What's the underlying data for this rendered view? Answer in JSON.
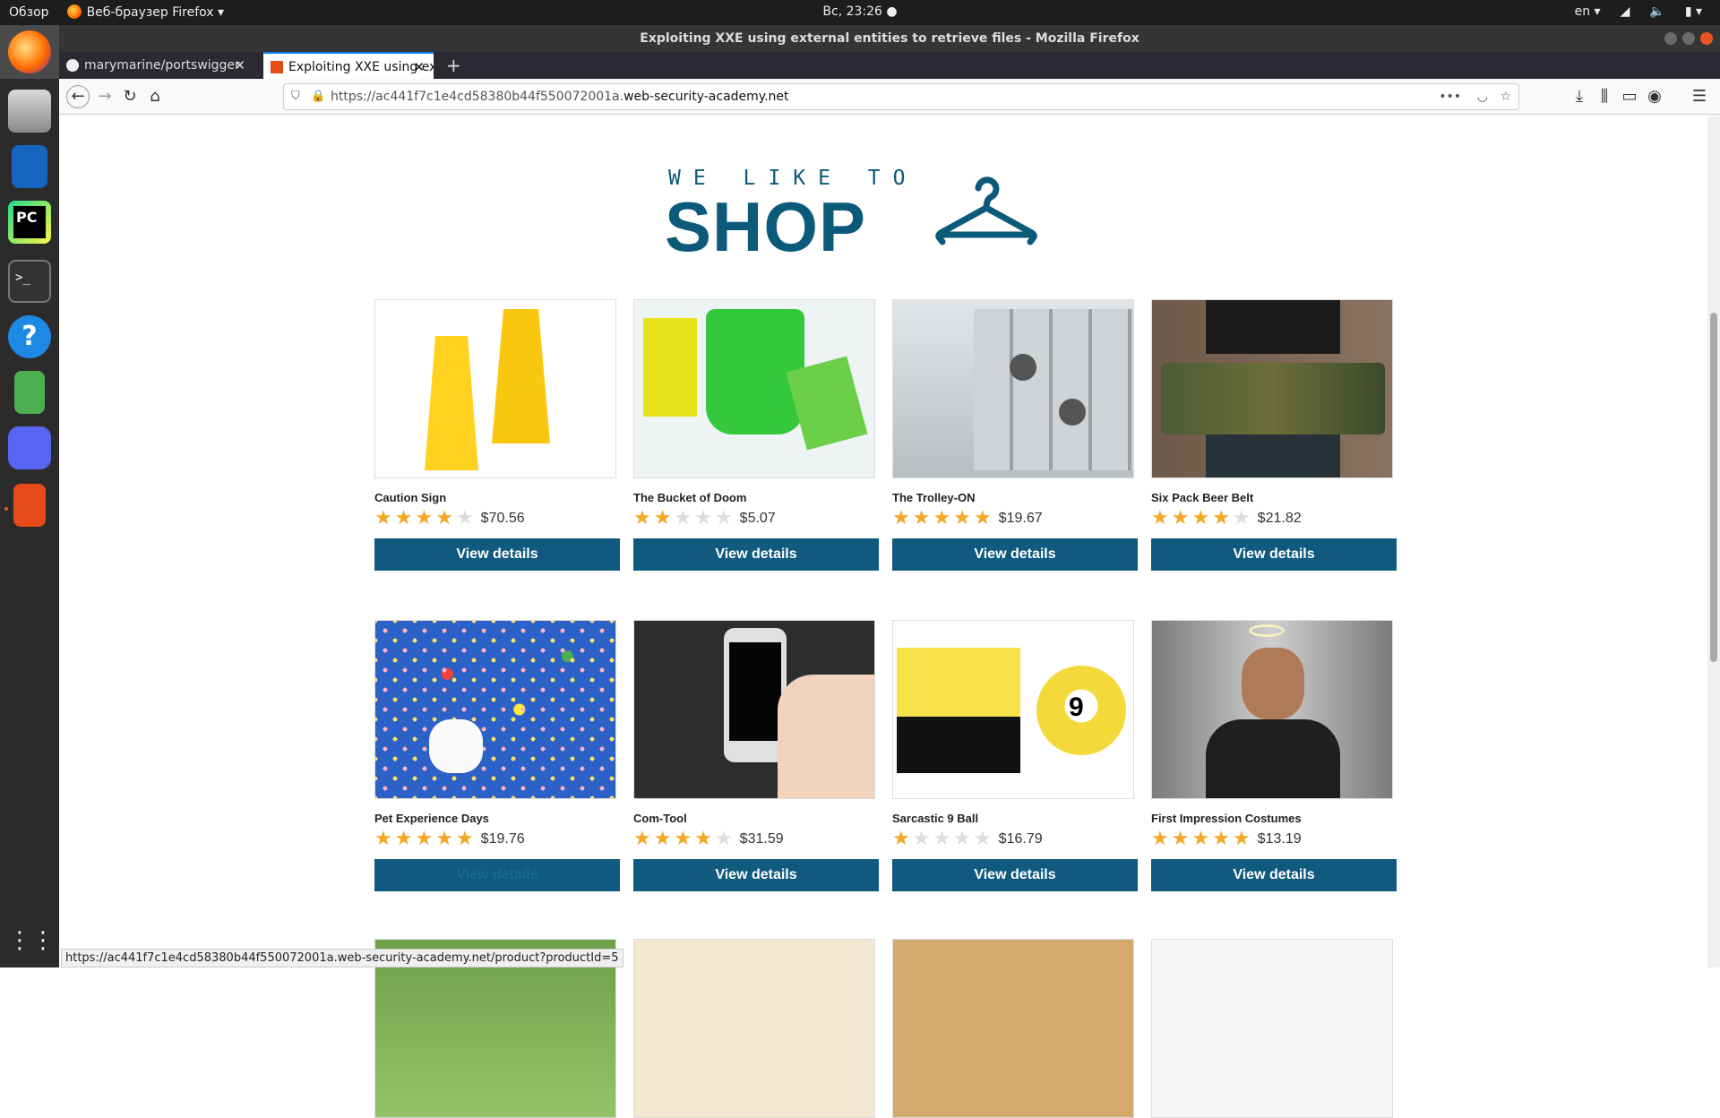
{
  "topbar": {
    "activities": "Обзор",
    "app_menu": "Веб-браузер Firefox",
    "clock": "Вс, 23:26 ●",
    "lang": "en ▾"
  },
  "window": {
    "title": "Exploiting XXE using external entities to retrieve files - Mozilla Firefox"
  },
  "tabs": [
    {
      "label": "marymarine/portswigger"
    },
    {
      "label": "Exploiting XXE using ext"
    }
  ],
  "urlbar": {
    "prefix": "https://ac441f7c1e4cd58380b44f550072001a.",
    "domain": "web-security-academy.net"
  },
  "logo": {
    "small": "WE LIKE TO",
    "big": "SHOP"
  },
  "products": [
    {
      "name": "Caution Sign",
      "stars": 4,
      "price": "$70.56",
      "button": "View details"
    },
    {
      "name": "The Bucket of Doom",
      "stars": 2,
      "price": "$5.07",
      "button": "View details"
    },
    {
      "name": "The Trolley-ON",
      "stars": 5,
      "price": "$19.67",
      "button": "View details"
    },
    {
      "name": "Six Pack Beer Belt",
      "stars": 4,
      "price": "$21.82",
      "button": "View details"
    },
    {
      "name": "Pet Experience Days",
      "stars": 5,
      "price": "$19.76",
      "button": "View details"
    },
    {
      "name": "Com-Tool",
      "stars": 4,
      "price": "$31.59",
      "button": "View details"
    },
    {
      "name": "Sarcastic 9 Ball",
      "stars": 1,
      "price": "$16.79",
      "button": "View details"
    },
    {
      "name": "First Impression Costumes",
      "stars": 5,
      "price": "$13.19",
      "button": "View details"
    }
  ],
  "status_url": "https://ac441f7c1e4cd58380b44f550072001a.web-security-academy.net/product?productId=5"
}
